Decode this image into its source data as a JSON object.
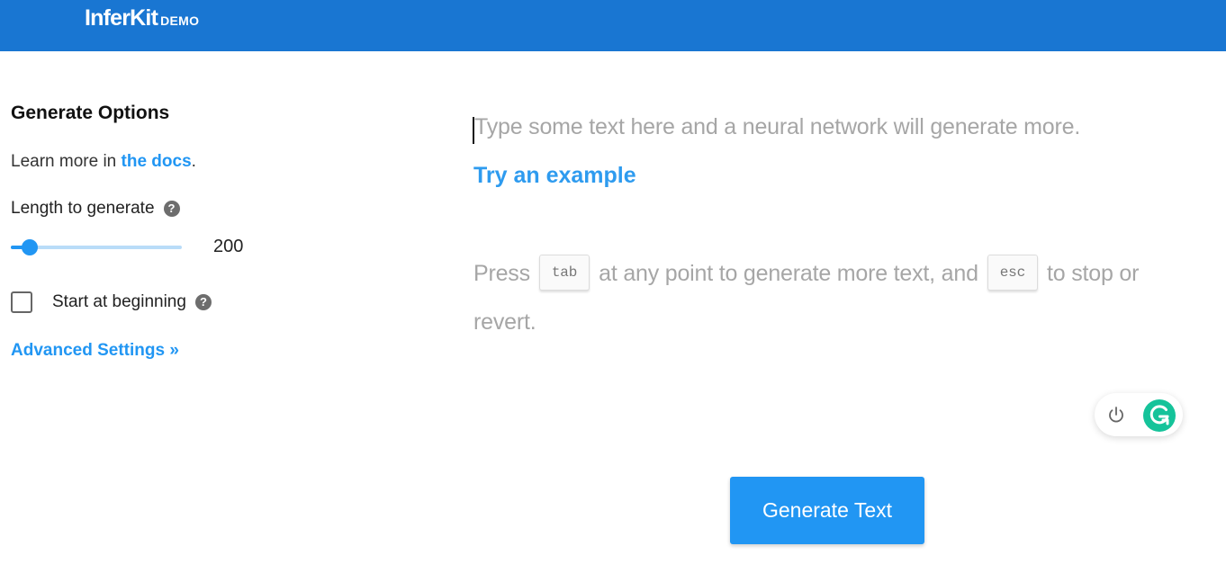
{
  "header": {
    "brand_name": "InferKit",
    "brand_tag": "DEMO"
  },
  "sidebar": {
    "title": "Generate Options",
    "learn_prefix": "Learn more in ",
    "learn_link": "the docs",
    "learn_suffix": ".",
    "length_label": "Length to generate",
    "length_value": "200",
    "length_fraction": 0.11,
    "start_at_beginning_label": "Start at beginning",
    "start_at_beginning_checked": false,
    "advanced_link": "Advanced Settings »",
    "help_glyph": "?"
  },
  "editor": {
    "placeholder": "Type some text here and a neural network will generate more.",
    "try_example": "Try an example",
    "hint_press": "Press",
    "hint_tab_key": "tab",
    "hint_middle": "at any point to generate more text, and",
    "hint_esc_key": "esc",
    "hint_end": "to stop or revert."
  },
  "widgets": {
    "grammarly_icons": [
      "power-icon",
      "grammarly-g-icon"
    ]
  },
  "actions": {
    "generate_label": "Generate Text"
  },
  "colors": {
    "header_bg": "#1976d2",
    "accent": "#2196f3",
    "placeholder_text": "#a6a6a6",
    "grammarly_green": "#15c39a"
  }
}
